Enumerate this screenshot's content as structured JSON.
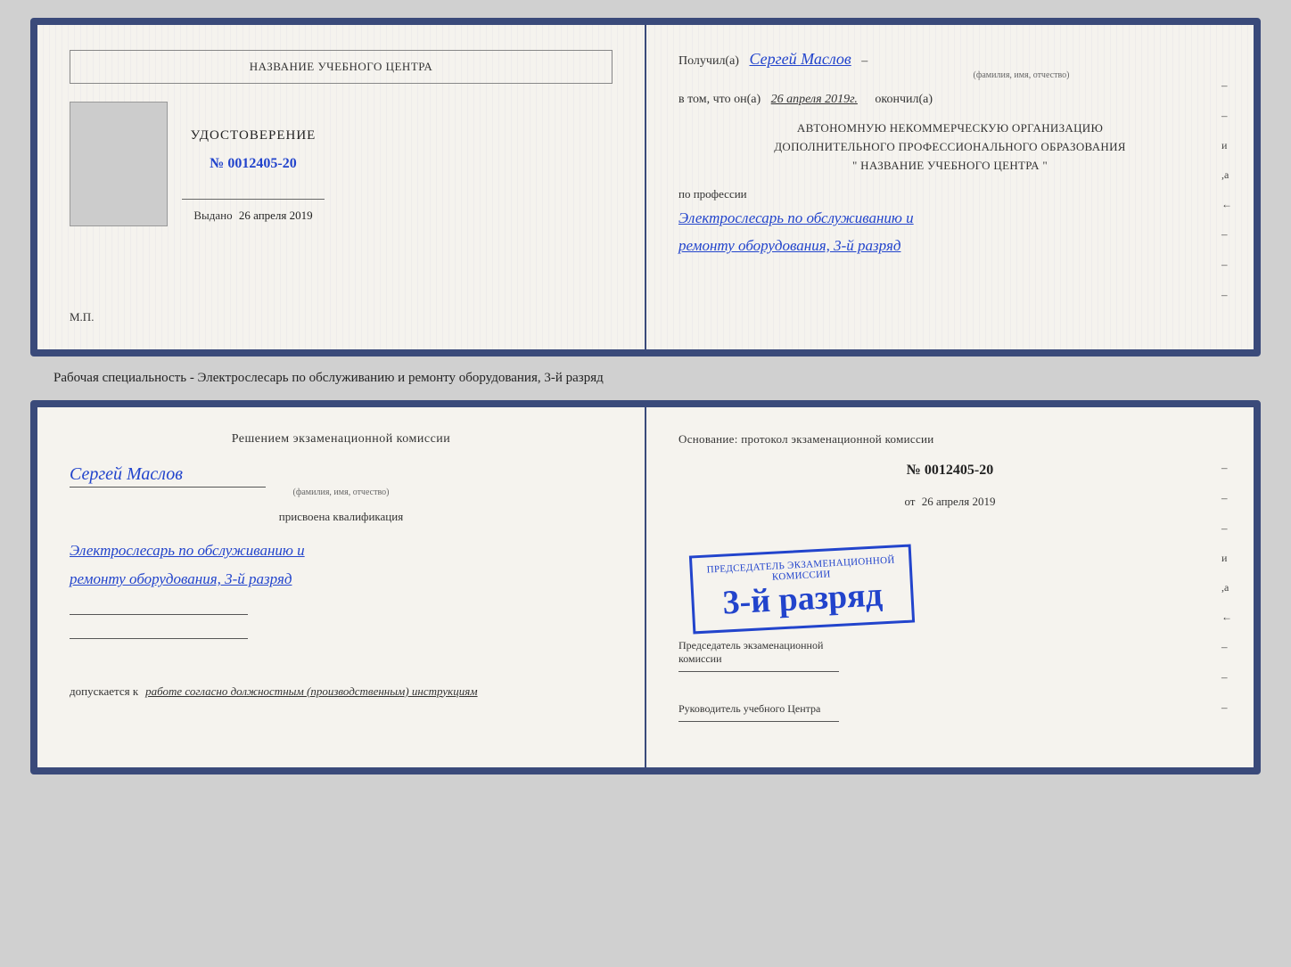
{
  "cert1": {
    "left": {
      "center_name": "НАЗВАНИЕ УЧЕБНОГО ЦЕНТРА",
      "udostoverenie_title": "УДОСТОВЕРЕНИЕ",
      "udostoverenie_number": "№ 0012405-20",
      "vydano_label": "Выдано",
      "vydano_date": "26 апреля 2019",
      "mp": "М.П."
    },
    "right": {
      "received_label": "Получил(а)",
      "received_name": "Сергей Маслов",
      "fio_label": "(фамилия, имя, отчество)",
      "vtom_prefix": "в том, что он(а)",
      "vtom_date": "26 апреля 2019г.",
      "okончил": "окончил(а)",
      "org_line1": "АВТОНОМНУЮ НЕКОММЕРЧЕСКУЮ ОРГАНИЗАЦИЮ",
      "org_line2": "ДОПОЛНИТЕЛЬНОГО ПРОФЕССИОНАЛЬНОГО ОБРАЗОВАНИЯ",
      "org_line3": "\"   НАЗВАНИЕ УЧЕБНОГО ЦЕНТРА   \"",
      "po_professii": "по профессии",
      "profession1": "Электрослесарь по обслуживанию и",
      "profession2": "ремонту оборудования, 3-й разряд"
    }
  },
  "caption": "Рабочая специальность - Электрослесарь по обслуживанию и ремонту оборудования, 3-й разряд",
  "cert2": {
    "left": {
      "resheniem": "Решением экзаменационной комиссии",
      "name": "Сергей Маслов",
      "fio_label": "(фамилия, имя, отчество)",
      "prisvoena": "присвоена квалификация",
      "qual1": "Электрослесарь по обслуживанию и",
      "qual2": "ремонту оборудования, 3-й разряд",
      "dopusk_label": "допускается к",
      "dopusk_text": "работе согласно должностным (производственным) инструкциям"
    },
    "right": {
      "osnovanie": "Основание: протокол экзаменационной комиссии",
      "number": "№ 0012405-20",
      "ot_label": "от",
      "ot_date": "26 апреля 2019",
      "predsedatel_label": "Председатель экзаменационной",
      "predsedatel_sub": "комиссии",
      "stamp_title": "Председатель экзаменационной комиссии",
      "stamp_big": "3-й разряд",
      "rukovoditel": "Руководитель учебного Центра"
    }
  },
  "side_chars": {
    "и": "и",
    "а": "а",
    "left_arrow": "←",
    "dash": "–"
  }
}
